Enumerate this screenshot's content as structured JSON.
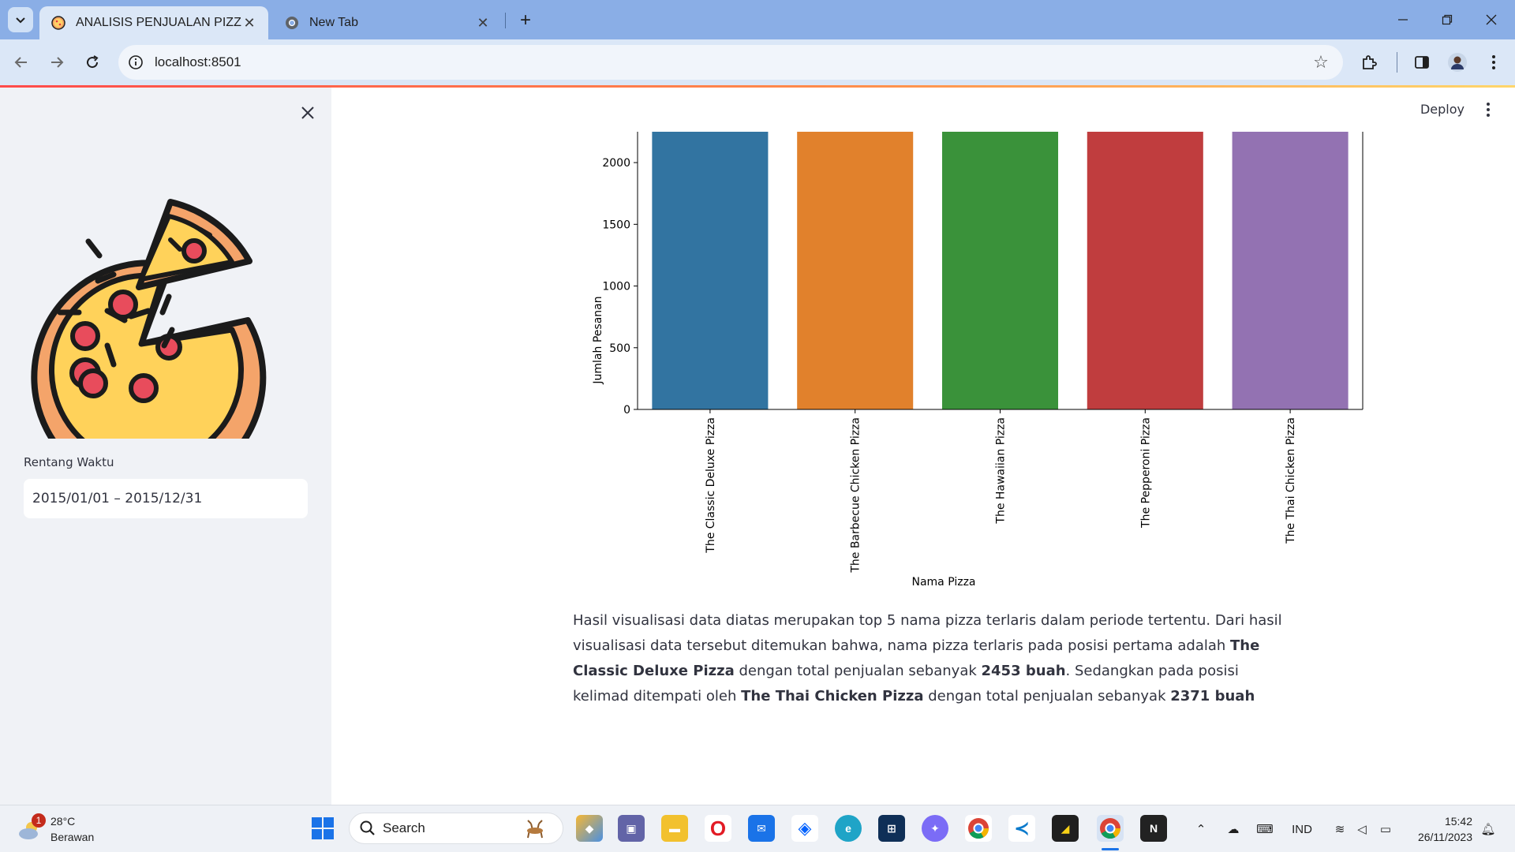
{
  "browser": {
    "tabs": [
      {
        "title": "ANALISIS PENJUALAN PIZZA",
        "active": true
      },
      {
        "title": "New Tab",
        "active": false
      }
    ],
    "url": "localhost:8501"
  },
  "sidebar": {
    "date_label": "Rentang Waktu",
    "date_value": "2015/01/01 – 2015/12/31"
  },
  "header": {
    "deploy_label": "Deploy"
  },
  "chart_data": {
    "type": "bar",
    "categories": [
      "The Classic Deluxe Pizza",
      "The Barbecue Chicken Pizza",
      "The Hawaiian Pizza",
      "The Pepperoni Pizza",
      "The Thai Chicken Pizza"
    ],
    "values": [
      2453,
      2432,
      2422,
      2418,
      2371
    ],
    "colors": [
      "#3274a1",
      "#e1812c",
      "#3a923a",
      "#c03d3e",
      "#9372b2"
    ],
    "xlabel": "Nama Pizza",
    "ylabel": "Jumlah Pesanan",
    "yticks": [
      0,
      500,
      1000,
      1500,
      2000
    ],
    "ylim": [
      0,
      2250
    ],
    "grid": false
  },
  "description": {
    "p1": "Hasil visualisasi data diatas merupakan top 5 nama pizza terlaris dalam periode tertentu. Dari hasil visualisasi data tersebut ditemukan bahwa, nama pizza terlaris pada posisi pertama adalah ",
    "b1": "The Classic Deluxe Pizza",
    "p2": " dengan total penjualan sebanyak ",
    "b2": "2453 buah",
    "p3": ". Sedangkan pada posisi kelimad ditempati oleh ",
    "b3": "The Thai Chicken Pizza",
    "p4": " dengan total penjualan sebanyak ",
    "b4": "2371 buah"
  },
  "taskbar": {
    "weather_badge": "1",
    "weather_temp": "28°C",
    "weather_cond": "Berawan",
    "search_label": "Search",
    "language": "IND",
    "time": "15:42",
    "date": "26/11/2023"
  }
}
